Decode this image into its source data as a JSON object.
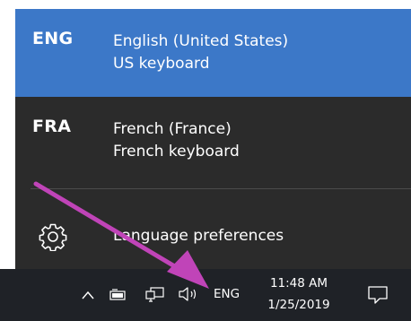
{
  "language_flyout": {
    "items": [
      {
        "code": "ENG",
        "name": "English (United States)",
        "keyboard": "US keyboard",
        "selected": true
      },
      {
        "code": "FRA",
        "name": "French (France)",
        "keyboard": "French keyboard",
        "selected": false
      }
    ],
    "preferences_label": "Language preferences",
    "preferences_icon": "gear-icon"
  },
  "taskbar": {
    "icons": [
      "chevron-up-icon",
      "battery-icon",
      "network-icon",
      "volume-icon",
      "action-center-icon"
    ],
    "input_indicator": "ENG",
    "time": "11:48 AM",
    "date": "1/25/2019"
  },
  "colors": {
    "selected_bg": "#3c78c8",
    "flyout_bg": "#2b2b2b",
    "taskbar_bg": "#1f2227",
    "annotation_arrow": "#c044b8"
  }
}
